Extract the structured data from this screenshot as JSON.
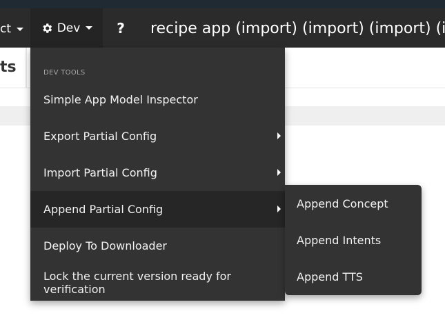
{
  "navbar": {
    "project_fragment": "ct",
    "dev_label": "Dev",
    "help_label": "?",
    "app_title": "recipe app (import) (import) (import) (im"
  },
  "subheader": {
    "title_fragment": "ts"
  },
  "dev_menu": {
    "header": "DEV TOOLS",
    "items": [
      {
        "label": "Simple App Model Inspector"
      },
      {
        "label": "Export Partial Config"
      },
      {
        "label": "Import Partial Config"
      },
      {
        "label": "Append Partial Config"
      },
      {
        "label": "Deploy To Downloader"
      },
      {
        "label": "Lock the current version ready for verification"
      }
    ]
  },
  "append_submenu": {
    "items": [
      {
        "label": "Append Concept"
      },
      {
        "label": "Append Intents"
      },
      {
        "label": "Append TTS"
      }
    ]
  },
  "colors": {
    "navbar_bg": "#2b2b2b",
    "menu_bg": "#333333",
    "menu_active_bg": "#262626"
  }
}
